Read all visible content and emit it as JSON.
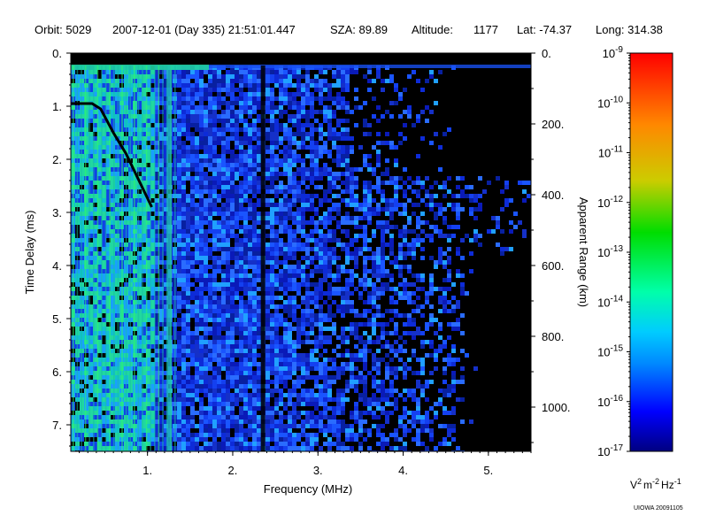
{
  "header": {
    "orbit": "Orbit: 5029",
    "datetime": "2007-12-01 (Day 335) 21:51:01.447",
    "sza": "SZA:  89.89",
    "altitude_label": "Altitude:",
    "altitude_value": "1177",
    "lat": "Lat: -74.37",
    "long": "Long: 314.38"
  },
  "credit": "UIOWA 20091105",
  "colors": {
    "background_dark": "#000000",
    "signal_blue": "#1030e0",
    "signal_green": "#20e060",
    "colorbar_stops": [
      "#000080",
      "#0000ff",
      "#00aaff",
      "#00ffcc",
      "#00dd00",
      "#cccc00",
      "#ff8800",
      "#ff0000"
    ]
  },
  "chart_data": {
    "type": "heatmap",
    "title": "",
    "xlabel": "Frequency (MHz)",
    "ylabel": "Time Delay (ms)",
    "y2label": "Apparent Range (km)",
    "xlim": [
      0.1,
      5.5
    ],
    "ylim": [
      0,
      7.5
    ],
    "y2lim": [
      0,
      1125
    ],
    "x_ticks": [
      1,
      2,
      3,
      4,
      5
    ],
    "x_tick_labels": [
      "1.",
      "2.",
      "3.",
      "4.",
      "5."
    ],
    "y_ticks": [
      0,
      1,
      2,
      3,
      4,
      5,
      6,
      7
    ],
    "y_tick_labels": [
      "0.",
      "1.",
      "2.",
      "3.",
      "4.",
      "5.",
      "6.",
      "7."
    ],
    "y2_ticks": [
      0,
      200,
      400,
      600,
      800,
      1000
    ],
    "y2_tick_labels": [
      "0.",
      "200.",
      "400.",
      "600.",
      "800.",
      "1000."
    ],
    "colorbar": {
      "label_base": "V",
      "label_sup1": "2",
      "label_mid": "m",
      "label_sup2": "-2",
      "label_end": "Hz",
      "label_sup3": "-1",
      "log_scale": true,
      "range_exp": [
        -17,
        -9
      ],
      "tick_exps": [
        -9,
        -10,
        -11,
        -12,
        -13,
        -14,
        -15,
        -16,
        -17
      ],
      "tick_labels": [
        {
          "base": "10",
          "exp": "-9"
        },
        {
          "base": "10",
          "exp": "-10"
        },
        {
          "base": "10",
          "exp": "-11"
        },
        {
          "base": "10",
          "exp": "-12"
        },
        {
          "base": "10",
          "exp": "-13"
        },
        {
          "base": "10",
          "exp": "-14"
        },
        {
          "base": "10",
          "exp": "-15"
        },
        {
          "base": "10",
          "exp": "-16"
        },
        {
          "base": "10",
          "exp": "-17"
        }
      ]
    },
    "trace": {
      "x": [
        0.1,
        0.35,
        0.45,
        0.6,
        0.75,
        0.9,
        1.05
      ],
      "y": [
        0.95,
        0.95,
        1.05,
        1.5,
        1.9,
        2.4,
        2.9
      ]
    },
    "vertical_lines_mhz": [
      1.25,
      2.35
    ],
    "grid": false
  }
}
